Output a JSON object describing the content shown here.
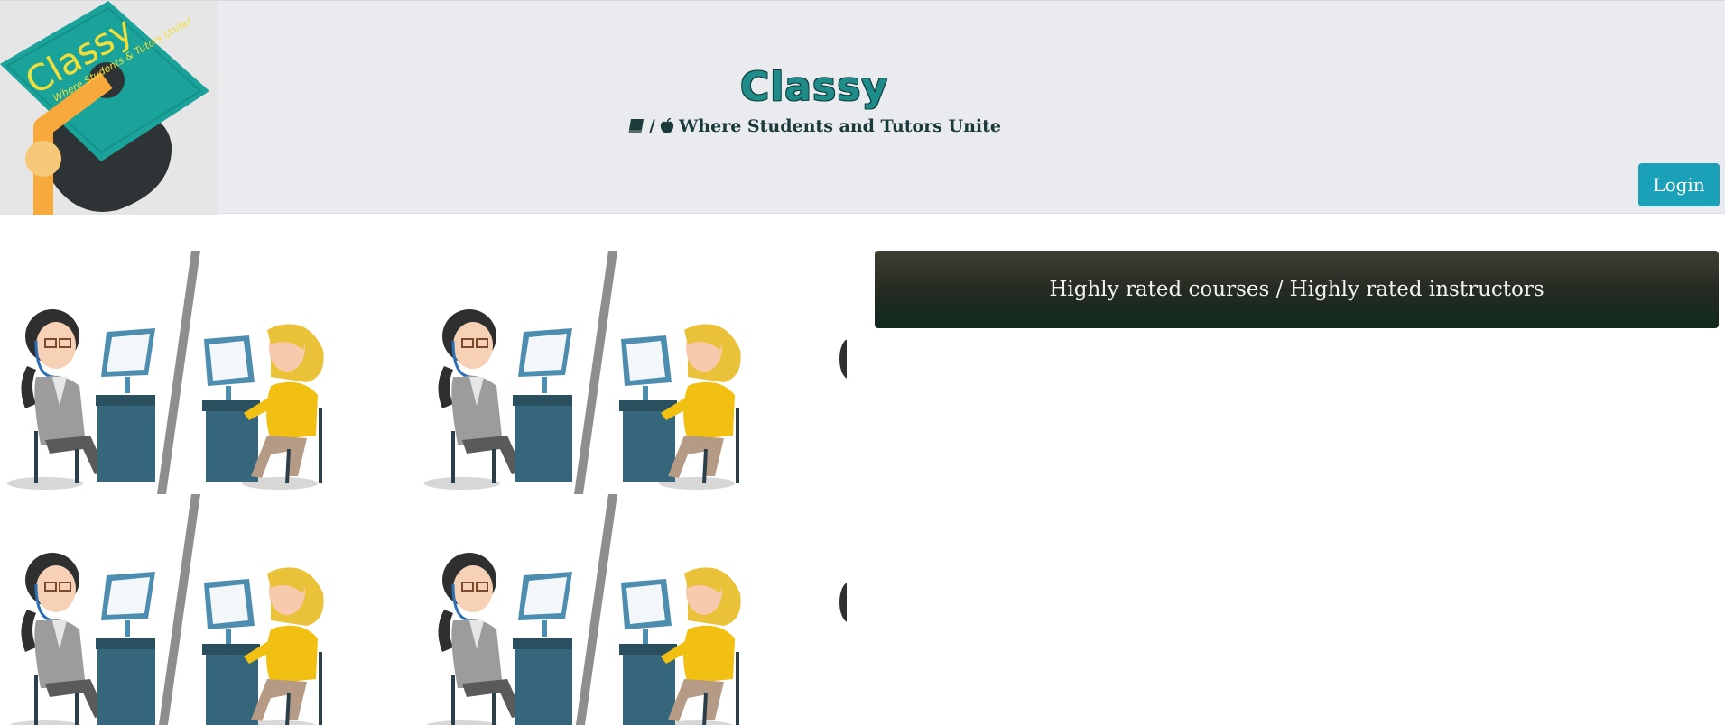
{
  "header": {
    "title": "Classy",
    "tagline": "Where Students and Tutors Unite",
    "tagline_icons": [
      "book-icon",
      "apple-icon"
    ],
    "tagline_separator": "/",
    "logo": {
      "text": "Classy",
      "subtext": "Where Students & Tutors Unite!"
    },
    "login_label": "Login"
  },
  "main": {
    "banner_text": "Highly rated courses / Highly rated instructors"
  },
  "colors": {
    "header_bg": "#e9ebee",
    "title": "#1f8c8a",
    "login_button": "#1aa0b8",
    "banner_top": "#3f3f34",
    "banner_bottom": "#10291e",
    "logo_teal": "#1aa39a",
    "logo_orange": "#f7a93b"
  }
}
